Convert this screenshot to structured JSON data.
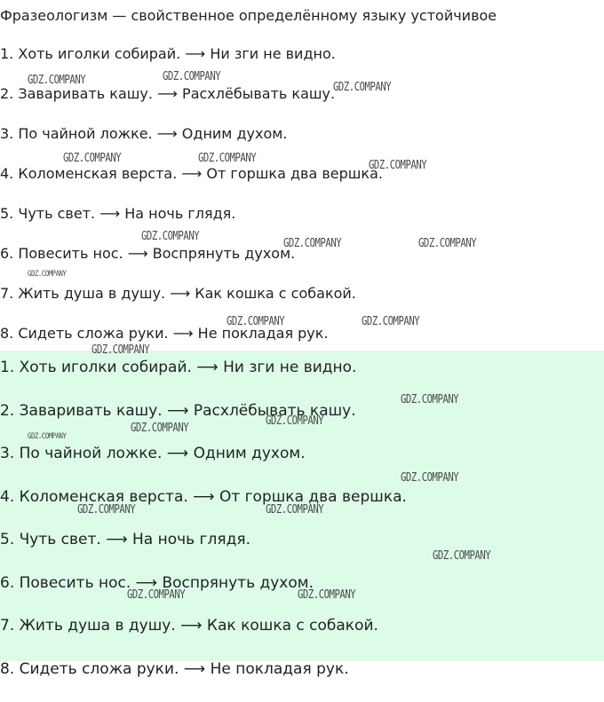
{
  "heading": "Фразеологизм — свойственное определённому языку устойчивое",
  "list_one": [
    "1. Хоть иголки собирай. ⟶ Ни зги не видно.",
    "2. Заваривать кашу. ⟶ Расхлёбывать кашу.",
    "3. По чайной ложке. ⟶ Одним духом.",
    "4. Коломенская верста. ⟶ От горшка два вершка.",
    "5. Чуть свет. ⟶ На ночь глядя.",
    "6. Повесить нос. ⟶ Воспрянуть духом.",
    "7. Жить душа в душу. ⟶ Как кошка с собакой.",
    "8. Сидеть сложа руки. ⟶ Не покладая рук."
  ],
  "list_two": [
    "1. Хоть иголки собирай. ⟶ Ни зги не видно.",
    "2. Заваривать кашу. ⟶ Расхлёбывать кашу.",
    "3. По чайной ложке. ⟶ Одним духом.",
    "4. Коломенская верста. ⟶ От горшка два вершка.",
    "5. Чуть свет. ⟶ На ночь глядя.",
    "6. Повесить нос. ⟶ Воспрянуть духом.",
    "7. Жить душа в душу. ⟶ Как кошка с собакой.",
    "8. Сидеть сложа руки. ⟶ Не покладая рук."
  ],
  "watermark": "GDZ.COMPANY",
  "colors": {
    "text": "#222222",
    "answer_background": "#dcfce8",
    "watermark": "#4a4a4a"
  }
}
